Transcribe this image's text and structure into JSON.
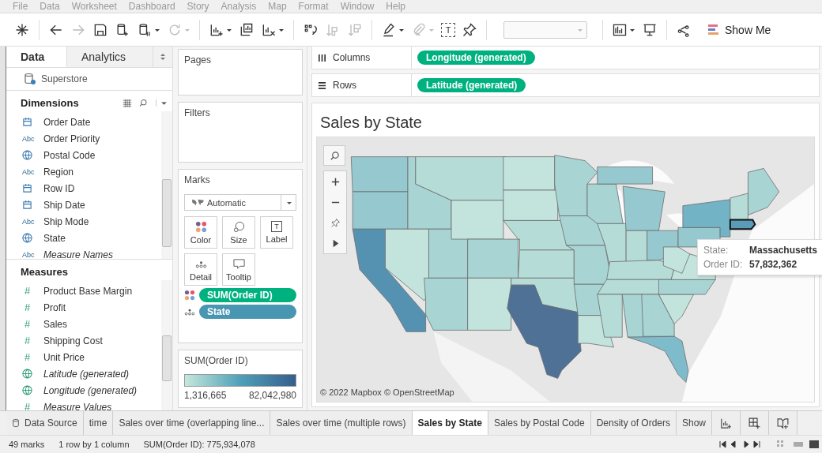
{
  "menu": [
    "File",
    "Data",
    "Worksheet",
    "Dashboard",
    "Story",
    "Analysis",
    "Map",
    "Format",
    "Window",
    "Help"
  ],
  "toolbar": {
    "buttons": [
      {
        "disabled": false,
        "has_menu": false
      },
      {
        "disabled": false,
        "has_menu": false
      },
      {
        "disabled": true,
        "has_menu": false
      },
      {
        "disabled": false,
        "has_menu": false
      },
      {
        "disabled": false,
        "has_menu": false
      },
      {
        "disabled": false,
        "has_menu": true
      },
      {
        "disabled": true,
        "has_menu": true
      },
      {
        "disabled": false,
        "has_menu": true
      },
      {
        "disabled": false,
        "has_menu": false
      },
      {
        "disabled": false,
        "has_menu": true
      },
      {
        "disabled": false,
        "has_menu": false
      },
      {
        "disabled": true,
        "has_menu": false
      },
      {
        "disabled": true,
        "has_menu": false
      },
      {
        "disabled": false,
        "has_menu": true
      },
      {
        "disabled": true,
        "has_menu": true
      },
      {
        "disabled": false,
        "has_menu": false,
        "glyph": "T"
      },
      {
        "disabled": false,
        "has_menu": false
      }
    ],
    "fit_field": {
      "disabled": true
    },
    "buttons_right": [
      {
        "has_menu": true
      },
      {
        "has_menu": false
      },
      {
        "has_menu": false
      }
    ],
    "show_me": "Show Me"
  },
  "side_tabs": [
    {
      "label": "Data",
      "selected": true
    },
    {
      "label": "Analytics",
      "selected": false
    }
  ],
  "datasource": "Superstore",
  "dimensions": {
    "title": "Dimensions",
    "items": [
      {
        "kind": "date",
        "label": "Order Date",
        "generated": false
      },
      {
        "kind": "string",
        "badge": "Abc",
        "label": "Order Priority",
        "generated": false
      },
      {
        "kind": "geo",
        "label": "Postal Code",
        "generated": false
      },
      {
        "kind": "string",
        "badge": "Abc",
        "label": "Region",
        "generated": false
      },
      {
        "kind": "date",
        "label": "Row ID",
        "generated": false
      },
      {
        "kind": "date",
        "label": "Ship Date",
        "generated": false
      },
      {
        "kind": "string",
        "badge": "Abc",
        "label": "Ship Mode",
        "generated": false
      },
      {
        "kind": "geo",
        "label": "State",
        "generated": false
      },
      {
        "kind": "string",
        "badge": "Abc",
        "label": "Measure Names",
        "generated": true
      }
    ]
  },
  "measures": {
    "title": "Measures",
    "items": [
      {
        "kind": "number",
        "badge": "#",
        "label": "Product Base Margin",
        "generated": false
      },
      {
        "kind": "number",
        "badge": "#",
        "label": "Profit",
        "generated": false
      },
      {
        "kind": "number",
        "badge": "#",
        "label": "Sales",
        "generated": false
      },
      {
        "kind": "number",
        "badge": "#",
        "label": "Shipping Cost",
        "generated": false
      },
      {
        "kind": "number",
        "badge": "#",
        "label": "Unit Price",
        "generated": false
      },
      {
        "kind": "geo",
        "label": "Latitude (generated)",
        "generated": true
      },
      {
        "kind": "geo",
        "label": "Longitude (generated)",
        "generated": true
      },
      {
        "kind": "number",
        "badge": "#",
        "label": "Measure Values",
        "generated": true
      }
    ]
  },
  "pages": {
    "title": "Pages"
  },
  "filters": {
    "title": "Filters"
  },
  "marks": {
    "title": "Marks",
    "type": "Automatic",
    "cards": [
      {
        "label": "Color"
      },
      {
        "label": "Size"
      },
      {
        "label": "Label",
        "glyph": "T"
      },
      {
        "label": "Detail"
      },
      {
        "label": "Tooltip"
      }
    ],
    "pills": [
      {
        "kind": "color",
        "label": "SUM(Order ID)",
        "color": "#00b180"
      },
      {
        "kind": "detail",
        "label": "State",
        "color": "#4996b2"
      }
    ]
  },
  "legend": {
    "title": "SUM(Order ID)",
    "min": "1,316,665",
    "max": "82,042,980"
  },
  "shelves": [
    {
      "kind": "columns",
      "label": "Columns",
      "pills": [
        {
          "label": "Longitude (generated)",
          "color": "#00b180"
        }
      ]
    },
    {
      "kind": "rows",
      "label": "Rows",
      "pills": [
        {
          "label": "Latitude (generated)",
          "color": "#00b180"
        }
      ]
    }
  ],
  "view": {
    "title": "Sales by State",
    "attribution": "© 2022 Mapbox © OpenStreetMap",
    "tooltip": [
      {
        "label": "State:",
        "value": "Massachusetts"
      },
      {
        "label": "Order ID:",
        "value": "57,832,362"
      }
    ]
  },
  "sheet_tabs": [
    {
      "kind": "datasource",
      "label": "Data Source",
      "selected": false
    },
    {
      "kind": "sheet",
      "label": "time",
      "selected": false
    },
    {
      "kind": "sheet",
      "label": "Sales over time (overlapping line...",
      "selected": false
    },
    {
      "kind": "sheet",
      "label": "Sales over time (multiple rows)",
      "selected": false
    },
    {
      "kind": "sheet",
      "label": "Sales by State",
      "selected": true
    },
    {
      "kind": "sheet",
      "label": "Sales by Postal Code",
      "selected": false
    },
    {
      "kind": "sheet",
      "label": "Density of Orders",
      "selected": false
    },
    {
      "kind": "sheet",
      "label": "Show",
      "selected": false
    }
  ],
  "status_bar": {
    "marks": "49 marks",
    "layout": "1 row by 1 column",
    "sum": "SUM(Order ID): 775,934,078"
  }
}
